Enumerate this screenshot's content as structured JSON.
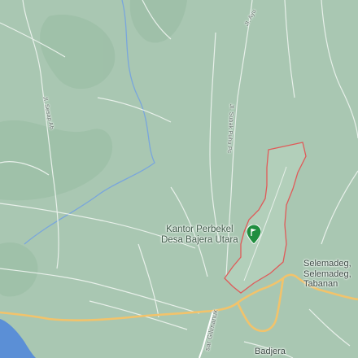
{
  "colors": {
    "terrain": "#a9c7b2",
    "terrain_dark": "#98bba3",
    "local_road": "#e8f0ea",
    "main_road": "#f2c36b",
    "water_line": "#79a6dc",
    "sea": "#5b8fd6",
    "boundary": "#e05a58",
    "village_fill": "#b9d4bf",
    "pin": "#1f8e3f",
    "text": "#4a5a52"
  },
  "labels": {
    "street_north": "Jl. Ayu",
    "street_left": "Jl. Sesap Ab",
    "street_center": "Jl. Subak Puhu Pc",
    "street_highway": "sar Gilimanuk",
    "poi_line1": "Kantor Perbekel",
    "poi_line2": "Desa Bajera Utara",
    "selemadeg_1": "Selemadeg,",
    "selemadeg_2": "Selemadeg,",
    "selemadeg_3": "Tabanan",
    "badjera": "Badjera"
  },
  "markers": {
    "pin_icon": "flag-pin-icon"
  }
}
